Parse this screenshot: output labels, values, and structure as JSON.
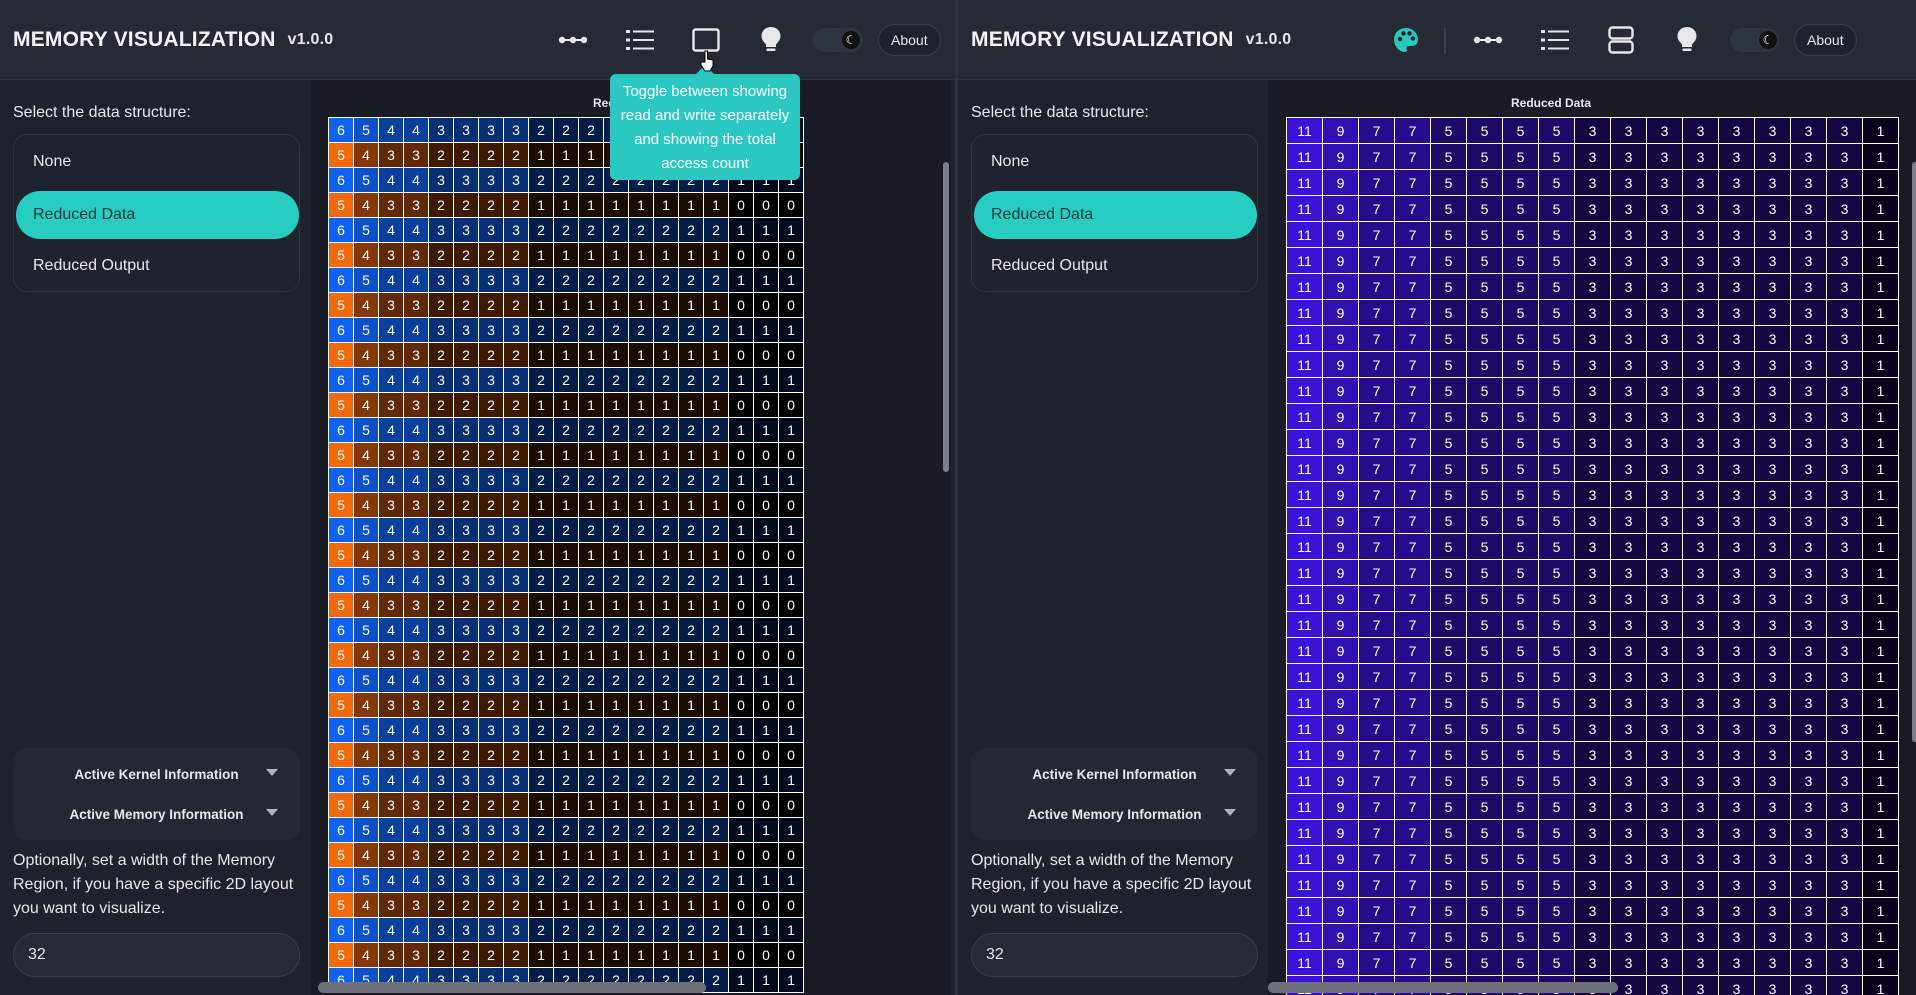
{
  "panes": [
    {
      "id": "left",
      "header": {
        "title": "MEMORY VISUALIZATION",
        "version": "v1.0.0",
        "about_label": "About",
        "icons": [
          "dots-icon",
          "list-icon",
          "square-icon",
          "bulb-icon"
        ]
      },
      "sidebar": {
        "select_label": "Select the data structure:",
        "items": [
          {
            "label": "None",
            "active": false
          },
          {
            "label": "Reduced Data",
            "active": true
          },
          {
            "label": "Reduced Output",
            "active": false
          }
        ],
        "accordion": {
          "kernel_label": "Active Kernel Information",
          "memory_label": "Active Memory Information"
        },
        "width_hint": "Optionally, set a width of the Memory Region, if you have a specific 2D layout you want to visualize.",
        "width_value": "32"
      },
      "viz": {
        "title": "Reduced Data",
        "mode": "read-write",
        "rows_visible": 35,
        "row_patterns": [
          [
            6,
            5,
            4,
            4,
            3,
            3,
            3,
            3,
            2,
            2,
            2,
            2,
            2,
            2,
            2,
            2,
            1,
            1,
            1
          ],
          [
            5,
            4,
            3,
            3,
            2,
            2,
            2,
            2,
            1,
            1,
            1,
            1,
            1,
            1,
            1,
            1,
            0,
            0,
            0
          ]
        ],
        "colors": {
          "read": "#0f62f2",
          "read_light": "#0f62f2",
          "write": "#f06a0c",
          "grid": "#ffffff"
        }
      },
      "tooltip": "Toggle between showing read and write separately and showing the total access count"
    },
    {
      "id": "right",
      "header": {
        "title": "MEMORY VISUALIZATION",
        "version": "v1.0.0",
        "about_label": "About",
        "icons": [
          "palette-icon",
          "dots-icon",
          "list-icon",
          "layers-icon",
          "bulb-icon"
        ]
      },
      "sidebar": {
        "select_label": "Select the data structure:",
        "items": [
          {
            "label": "None",
            "active": false
          },
          {
            "label": "Reduced Data",
            "active": true
          },
          {
            "label": "Reduced Output",
            "active": false
          }
        ],
        "accordion": {
          "kernel_label": "Active Kernel Information",
          "memory_label": "Active Memory Information"
        },
        "width_hint": "Optionally, set a width of the Memory Region, if you have a specific 2D layout you want to visualize.",
        "width_value": "32"
      },
      "viz": {
        "title": "Reduced Data",
        "mode": "total",
        "rows_visible": 34,
        "row_patterns": [
          [
            11,
            9,
            7,
            7,
            5,
            5,
            5,
            5,
            3,
            3,
            3,
            3,
            3,
            3,
            3,
            3,
            1
          ]
        ],
        "colors": {
          "high": "#3a12d8",
          "low": "#000000",
          "grid": "#ffffff"
        }
      }
    }
  ]
}
